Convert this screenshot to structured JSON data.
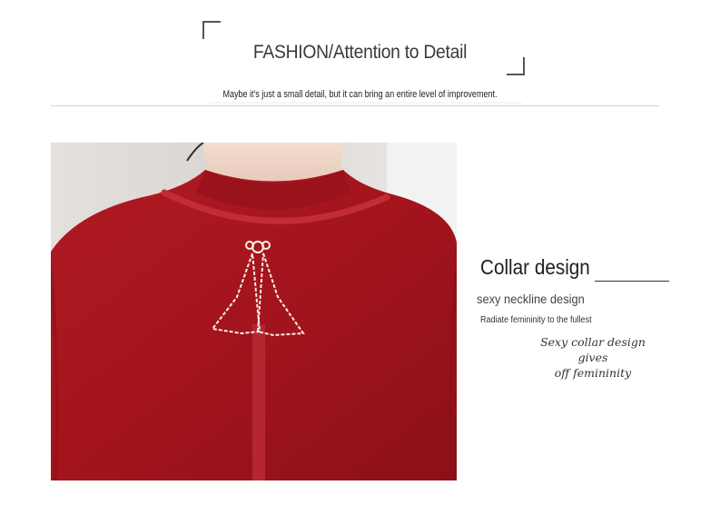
{
  "header": {
    "title": "FASHION/Attention to Detail",
    "subtitle": "Maybe it's just a small detail, but it can bring an entire level of improvement."
  },
  "feature": {
    "heading": "Collar design",
    "subheading": "sexy neckline design",
    "caption": "Radiate femininity to the fullest",
    "script_line1": "Sexy collar design gives",
    "script_line2": "off femininity"
  },
  "colors": {
    "sweater": "#a3141d",
    "accent_line": "#333333"
  },
  "photo": {
    "subject": "red mock-neck sweater with bow brooch"
  }
}
